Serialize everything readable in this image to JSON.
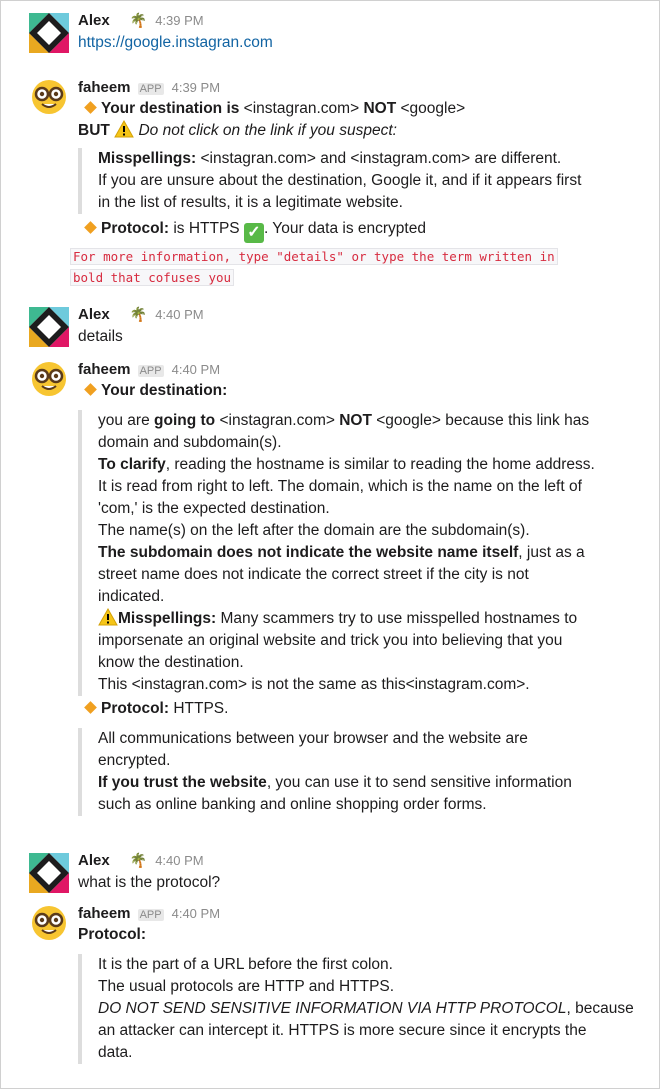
{
  "messages": {
    "m1": {
      "user": "Alex",
      "time": "4:39 PM",
      "text": "https://google.instagran.com"
    },
    "m2": {
      "user": "faheem",
      "badge": "APP",
      "time": "4:39 PM",
      "line1_a": "Your destination is",
      "line1_b": " <instagran.com> ",
      "line1_c": "NOT",
      "line1_d": " <google>",
      "but": "BUT",
      "but_text": " Do not click on the link if you suspect:",
      "quote_l1_a": "Misspellings:",
      "quote_l1_b": " <instagran.com> and <instagram.com> are different.",
      "quote_l2": "If you are unsure about the destination, Google it, and if it appears first",
      "quote_l3": "in the list of results, it is a legitimate website.",
      "protocol_a": "Protocol:",
      "protocol_b": " is HTTPS ",
      "protocol_c": ". Your data is encrypted",
      "code_l1": "For more information, type \"details\" or type the term written in",
      "code_l2": "bold that cofuses you"
    },
    "m3": {
      "user": "Alex",
      "time": "4:40 PM",
      "text": "details"
    },
    "m4": {
      "user": "faheem",
      "badge": "APP",
      "time": "4:40 PM",
      "dest_title": "Your destination:",
      "q1_a": "you are ",
      "q1_b": "going to",
      "q1_c": " <instagran.com> ",
      "q1_d": "NOT",
      "q1_e": " <google> because this link has",
      "q2": "domain and subdomain(s).",
      "q3_a": "To clarify",
      "q3_b": ", reading the hostname is similar to reading the home address.",
      "q4": "It is read from right to left. The domain, which is the name on the left of",
      "q5": "'com,' is the expected destination.",
      "q6": "The name(s) on the left after the domain are the subdomain(s).",
      "q7_a": "The subdomain does not indicate the website name itself",
      "q7_b": ", just as a",
      "q8": "street name does not indicate the correct street if the city is not",
      "q9": "indicated.",
      "q10_a": "Misspellings:",
      "q10_b": " Many scammers try to use misspelled hostnames to",
      "q11": "imporsenate an original website and trick you into believing that you",
      "q12": "know the destination.",
      "q13": "This <instagran.com> is not the same as this<instagram.com>.",
      "proto_a": "Protocol:",
      "proto_b": " HTTPS.",
      "p1": "All communications between your browser and the website are",
      "p2": "encrypted.",
      "p3_a": "If you trust the website",
      "p3_b": ", you can use it to send sensitive information",
      "p4": "such as online banking and online shopping order forms."
    },
    "m5": {
      "user": "Alex",
      "time": "4:40 PM",
      "text": "what is the protocol?"
    },
    "m6": {
      "user": "faheem",
      "badge": "APP",
      "time": "4:40 PM",
      "title": "Protocol:",
      "l1": "It is the part of a URL before the first colon.",
      "l2": "The usual protocols are HTTP and HTTPS.",
      "l3_a": "DO NOT SEND SENSITIVE INFORMATION VIA HTTP PROTOCOL",
      "l3_b": ", because",
      "l4": "an attacker can intercept it. HTTPS is more secure since it encrypts the",
      "l5": "data."
    }
  },
  "icons": {
    "alex_avatar": "slack-logo-icon",
    "faheem_avatar": "nerd-face-icon",
    "status": "palm-tree-icon",
    "bullet": "orange-diamond-icon",
    "warning": "warning-icon",
    "check": "check-mark-icon"
  }
}
